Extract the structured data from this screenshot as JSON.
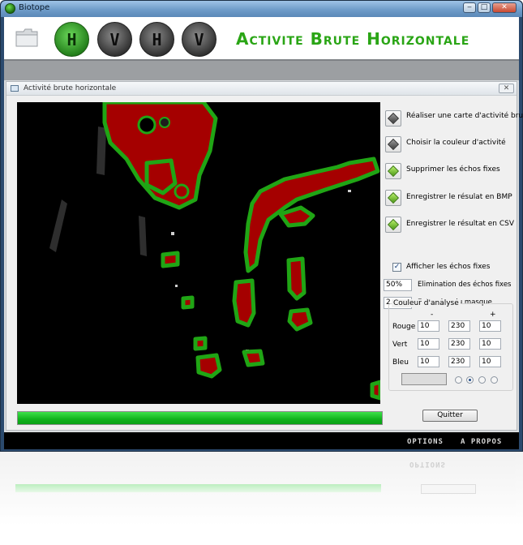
{
  "window": {
    "title": "Biotope",
    "minimize_glyph": "‒",
    "maximize_glyph": "□",
    "close_glyph": "✕"
  },
  "toolbar": {
    "open_icon": "folder-icon",
    "modes": [
      {
        "label": "H",
        "active": true
      },
      {
        "label": "V",
        "active": false
      },
      {
        "label": "H",
        "active": false
      },
      {
        "label": "V",
        "active": false
      }
    ],
    "heading": "Activite Brute Horizontale"
  },
  "panel": {
    "title": "Activité brute horizontale",
    "close_glyph": "✕"
  },
  "actions": [
    {
      "label": "Réaliser une carte d'activité brute",
      "icon": "grey-diamond-icon"
    },
    {
      "label": "Choisir la couleur d'activité",
      "icon": "grey-diamond-icon"
    },
    {
      "label": "Supprimer les échos fixes",
      "icon": "green-diamond-icon"
    },
    {
      "label": "Enregistrer le résulat en BMP",
      "icon": "green-diamond-icon"
    },
    {
      "label": "Enregistrer le résultat en CSV",
      "icon": "green-diamond-icon"
    }
  ],
  "options": {
    "show_fixed_echoes_label": "Afficher les échos fixes",
    "show_fixed_echoes_checked": true,
    "elimination_value": "50%",
    "elimination_label": "Elimination des échos fixes",
    "extension_value": "2 px",
    "extension_label": "Extension du masque"
  },
  "color_group": {
    "title": "Couleur d'analyse",
    "minus_header": "-",
    "plus_header": "+",
    "rows": [
      {
        "label": "Rouge",
        "values": [
          "10",
          "230",
          "10"
        ]
      },
      {
        "label": "Vert",
        "values": [
          "10",
          "230",
          "10"
        ]
      },
      {
        "label": "Bleu",
        "values": [
          "10",
          "230",
          "10"
        ]
      }
    ],
    "selected_radio": 1
  },
  "progress": {
    "value": 1.0,
    "color": "#13b51f"
  },
  "quit_label": "Quitter",
  "statusbar": {
    "options_label": "OPTIONS",
    "about_label": "A PROPOS"
  },
  "colors": {
    "activity": "#a50000",
    "outline": "#20a515",
    "accent": "#2aa515"
  }
}
